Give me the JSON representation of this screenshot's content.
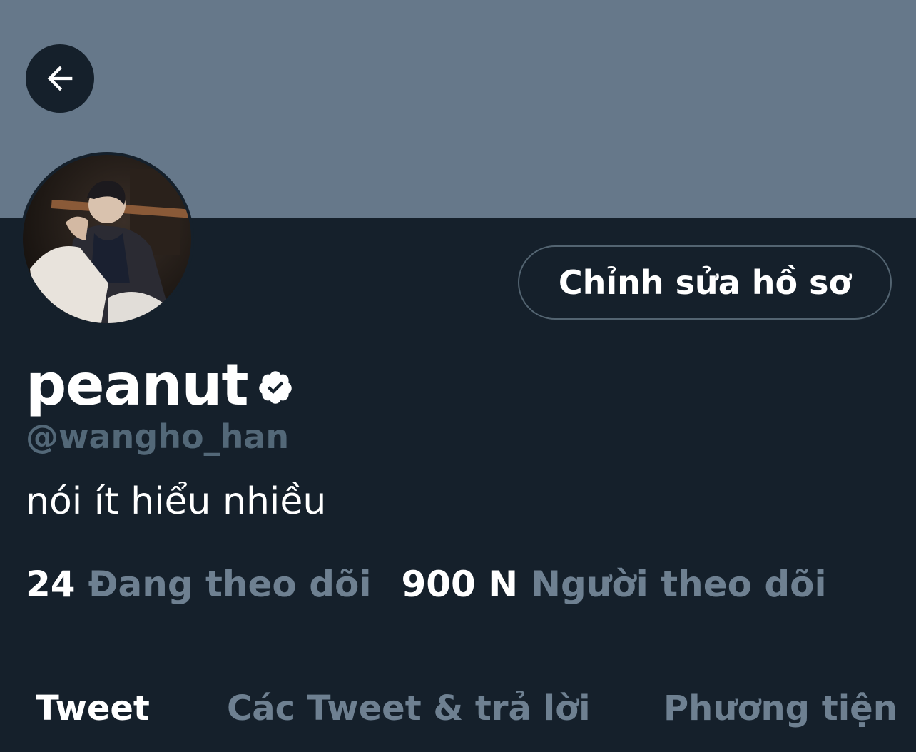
{
  "profile": {
    "display_name": "peanut",
    "handle": "@wangho_han",
    "bio": "nói ít hiểu nhiều",
    "verified": true
  },
  "actions": {
    "back_icon": "arrow-left-icon",
    "edit_profile_label": "Chỉnh sửa hồ sơ"
  },
  "stats": {
    "following_count": "24",
    "following_label": "Đang theo dõi",
    "followers_count": "900 N",
    "followers_label": "Người theo dõi"
  },
  "tabs": [
    {
      "label": "Tweet",
      "active": true
    },
    {
      "label": "Các Tweet & trả lời",
      "active": false
    },
    {
      "label": "Phương tiện",
      "active": false
    }
  ],
  "colors": {
    "background": "#15202b",
    "banner": "#66788a",
    "secondary_text": "#6e8091",
    "primary_text": "#ffffff"
  }
}
